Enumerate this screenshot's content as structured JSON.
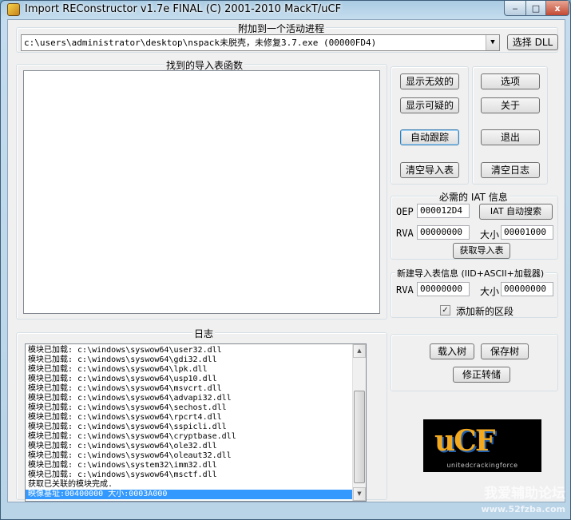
{
  "window": {
    "title": "Import REConstructor v1.7e FINAL (C) 2001-2010 MackT/uCF",
    "minimize_glyph": "‒",
    "maximize_glyph": "□",
    "close_glyph": "x"
  },
  "attach": {
    "group_label": "附加到一个活动进程",
    "process_value": "c:\\users\\administrator\\desktop\\nspack未脱壳，未修复3.7.exe (00000FD4)",
    "select_dll_label": "选择 DLL"
  },
  "imports": {
    "group_label": "找到的导入表函数"
  },
  "buttons": {
    "show_invalid": "显示无效的",
    "show_suspect": "显示可疑的",
    "auto_trace": "自动跟踪",
    "clear_imports": "清空导入表",
    "options": "选项",
    "about": "关于",
    "exit": "退出",
    "clear_log": "清空日志"
  },
  "iat": {
    "group_label": "必需的 IAT 信息",
    "oep_label": "OEP",
    "oep_value": "000012D4",
    "autosearch_label": "IAT 自动搜索",
    "rva_label": "RVA",
    "rva_value": "00000000",
    "size_label": "大小",
    "size_value": "00001000",
    "get_imports_label": "获取导入表"
  },
  "new_import": {
    "group_label": "新建导入表信息 (IID+ASCII+加载器)",
    "rva_label": "RVA",
    "rva_value": "00000000",
    "size_label": "大小",
    "size_value": "00000000",
    "add_section_label": "添加新的区段",
    "add_section_checked": true
  },
  "log": {
    "group_label": "日志",
    "lines": [
      "模块已加载: c:\\windows\\syswow64\\user32.dll",
      "模块已加载: c:\\windows\\syswow64\\gdi32.dll",
      "模块已加载: c:\\windows\\syswow64\\lpk.dll",
      "模块已加载: c:\\windows\\syswow64\\usp10.dll",
      "模块已加载: c:\\windows\\syswow64\\msvcrt.dll",
      "模块已加载: c:\\windows\\syswow64\\advapi32.dll",
      "模块已加载: c:\\windows\\syswow64\\sechost.dll",
      "模块已加载: c:\\windows\\syswow64\\rpcrt4.dll",
      "模块已加载: c:\\windows\\syswow64\\sspicli.dll",
      "模块已加载: c:\\windows\\syswow64\\cryptbase.dll",
      "模块已加载: c:\\windows\\syswow64\\ole32.dll",
      "模块已加载: c:\\windows\\syswow64\\oleaut32.dll",
      "模块已加载: c:\\windows\\system32\\imm32.dll",
      "模块已加载: c:\\windows\\syswow64\\msctf.dll",
      "获取已关联的模块完成.",
      "映像基址:00400000 大小:0003A000"
    ]
  },
  "tree": {
    "load_tree": "载入树",
    "save_tree": "保存树",
    "fix_dump": "修正转储"
  },
  "logo": {
    "mark": "uCF",
    "subtitle": "unitedcrackingforce"
  },
  "watermark": {
    "line1": "我爱辅助论坛",
    "line2": "www.52fzba.com"
  }
}
